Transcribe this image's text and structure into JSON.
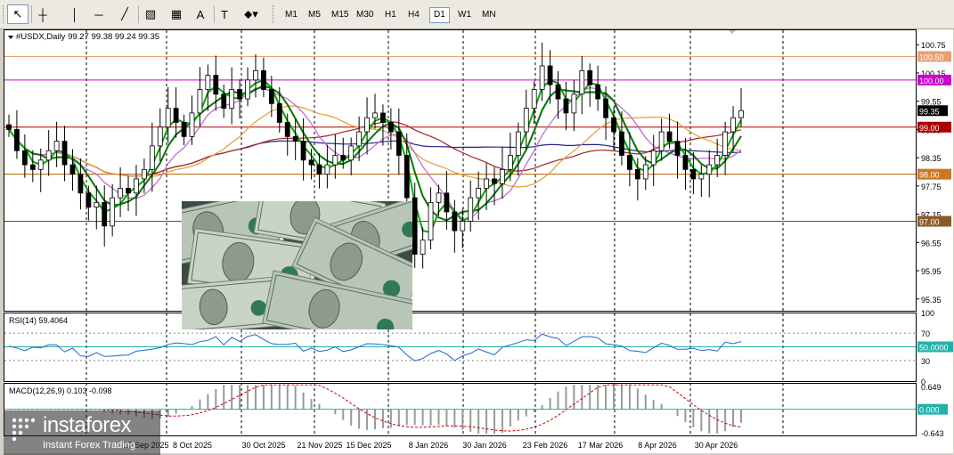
{
  "toolbar": {
    "tools": [
      {
        "name": "cursor-icon",
        "glyph": "↖",
        "active": true
      },
      {
        "name": "crosshair-icon",
        "glyph": "┼"
      },
      {
        "name": "vertical-line-icon",
        "glyph": "│"
      },
      {
        "name": "horizontal-line-icon",
        "glyph": "─"
      },
      {
        "name": "trendline-icon",
        "glyph": "╱"
      },
      {
        "name": "equidistant-channel-icon",
        "glyph": "▨"
      },
      {
        "name": "fibonacci-icon",
        "glyph": "▦"
      },
      {
        "name": "text-icon",
        "glyph": "A"
      },
      {
        "name": "text-label-icon",
        "glyph": "T"
      },
      {
        "name": "shapes-dropdown-icon",
        "glyph": "⬥▾"
      }
    ],
    "timeframes": [
      "M1",
      "M5",
      "M15",
      "M30",
      "H1",
      "H4",
      "D1",
      "W1",
      "MN"
    ],
    "active_timeframe": "D1"
  },
  "chart_header": {
    "symbol_label": "#USDX,Daily",
    "ohlc": "99.27 99.38 99.24 99.35"
  },
  "chart_data": {
    "type": "candlestick",
    "symbol": "#USDX",
    "timeframe": "Daily",
    "y_range": [
      95.1,
      101.0
    ],
    "y_ticks": [
      "100.75",
      "100.15",
      "99.55",
      "98.95",
      "98.35",
      "97.75",
      "97.15",
      "96.55",
      "95.95",
      "95.35"
    ],
    "x_ticks": [
      "17 Sep 2025",
      "8 Oct 2025",
      "30 Oct 2025",
      "21 Nov 2025",
      "15 Dec 2025",
      "8 Jan 2026",
      "30 Jan 2026",
      "23 Feb 2026",
      "17 Mar 2026",
      "8 Apr 2026",
      "30 Apr 2026"
    ],
    "current_price": "99.35",
    "horizontal_levels": [
      {
        "value": "100.50",
        "color": "#e8a070",
        "label_bg": "#e8a070"
      },
      {
        "value": "100.00",
        "color": "#cc00cc",
        "label_bg": "#cc00cc"
      },
      {
        "value": "99.00",
        "color": "#aa0000",
        "label_bg": "#aa0000"
      },
      {
        "value": "98.00",
        "color": "#b85c00",
        "label_bg": "#cc7722"
      },
      {
        "value": "97.00",
        "color": "#7a4a10",
        "label_bg": "#8b5a2b"
      }
    ],
    "close_series": [
      98.95,
      98.5,
      98.2,
      98.1,
      98.3,
      98.5,
      98.7,
      98.2,
      98.0,
      97.6,
      97.3,
      97.4,
      96.9,
      97.5,
      97.7,
      97.6,
      97.9,
      98.1,
      98.6,
      99.0,
      99.4,
      99.1,
      98.8,
      99.3,
      99.8,
      100.1,
      99.7,
      99.4,
      99.8,
      99.6,
      100.0,
      100.2,
      99.8,
      99.5,
      99.1,
      98.8,
      98.7,
      98.3,
      98.2,
      98.0,
      98.2,
      98.4,
      98.3,
      98.6,
      98.9,
      99.2,
      99.3,
      99.1,
      98.9,
      98.4,
      97.5,
      96.3,
      96.6,
      97.4,
      97.6,
      97.2,
      96.8,
      97.0,
      97.5,
      97.7,
      97.9,
      97.8,
      98.1,
      98.4,
      98.9,
      99.4,
      99.8,
      100.3,
      99.9,
      99.6,
      99.3,
      99.7,
      100.2,
      99.9,
      99.6,
      99.2,
      98.9,
      98.4,
      98.1,
      97.9,
      98.2,
      98.5,
      98.9,
      98.7,
      98.4,
      98.1,
      97.9,
      98.0,
      98.2,
      98.4,
      98.9,
      99.2,
      99.35
    ],
    "moving_averages": [
      {
        "name": "MA fast",
        "color": "#00aa00"
      },
      {
        "name": "MA 2",
        "color": "#007700"
      },
      {
        "name": "MA 3",
        "color": "#bb66cc"
      },
      {
        "name": "MA 4",
        "color": "#e0a030"
      },
      {
        "name": "MA 5",
        "color": "#aa2222"
      },
      {
        "name": "MA 6",
        "color": "#222288"
      }
    ],
    "rsi": {
      "label": "RSI(14) 59.4064",
      "levels": [
        "100",
        "70",
        "50",
        "30",
        "0"
      ],
      "current_label": "50.0000",
      "line_color": "#2266cc"
    },
    "macd": {
      "label": "MACD(12,26,9) 0.103 -0.098",
      "levels": [
        "0.649",
        "0.000",
        "-0.643"
      ],
      "signal_color": "#cc0000"
    }
  },
  "watermark": {
    "brand": "instaforex",
    "tagline": "Instant Forex Trading"
  }
}
